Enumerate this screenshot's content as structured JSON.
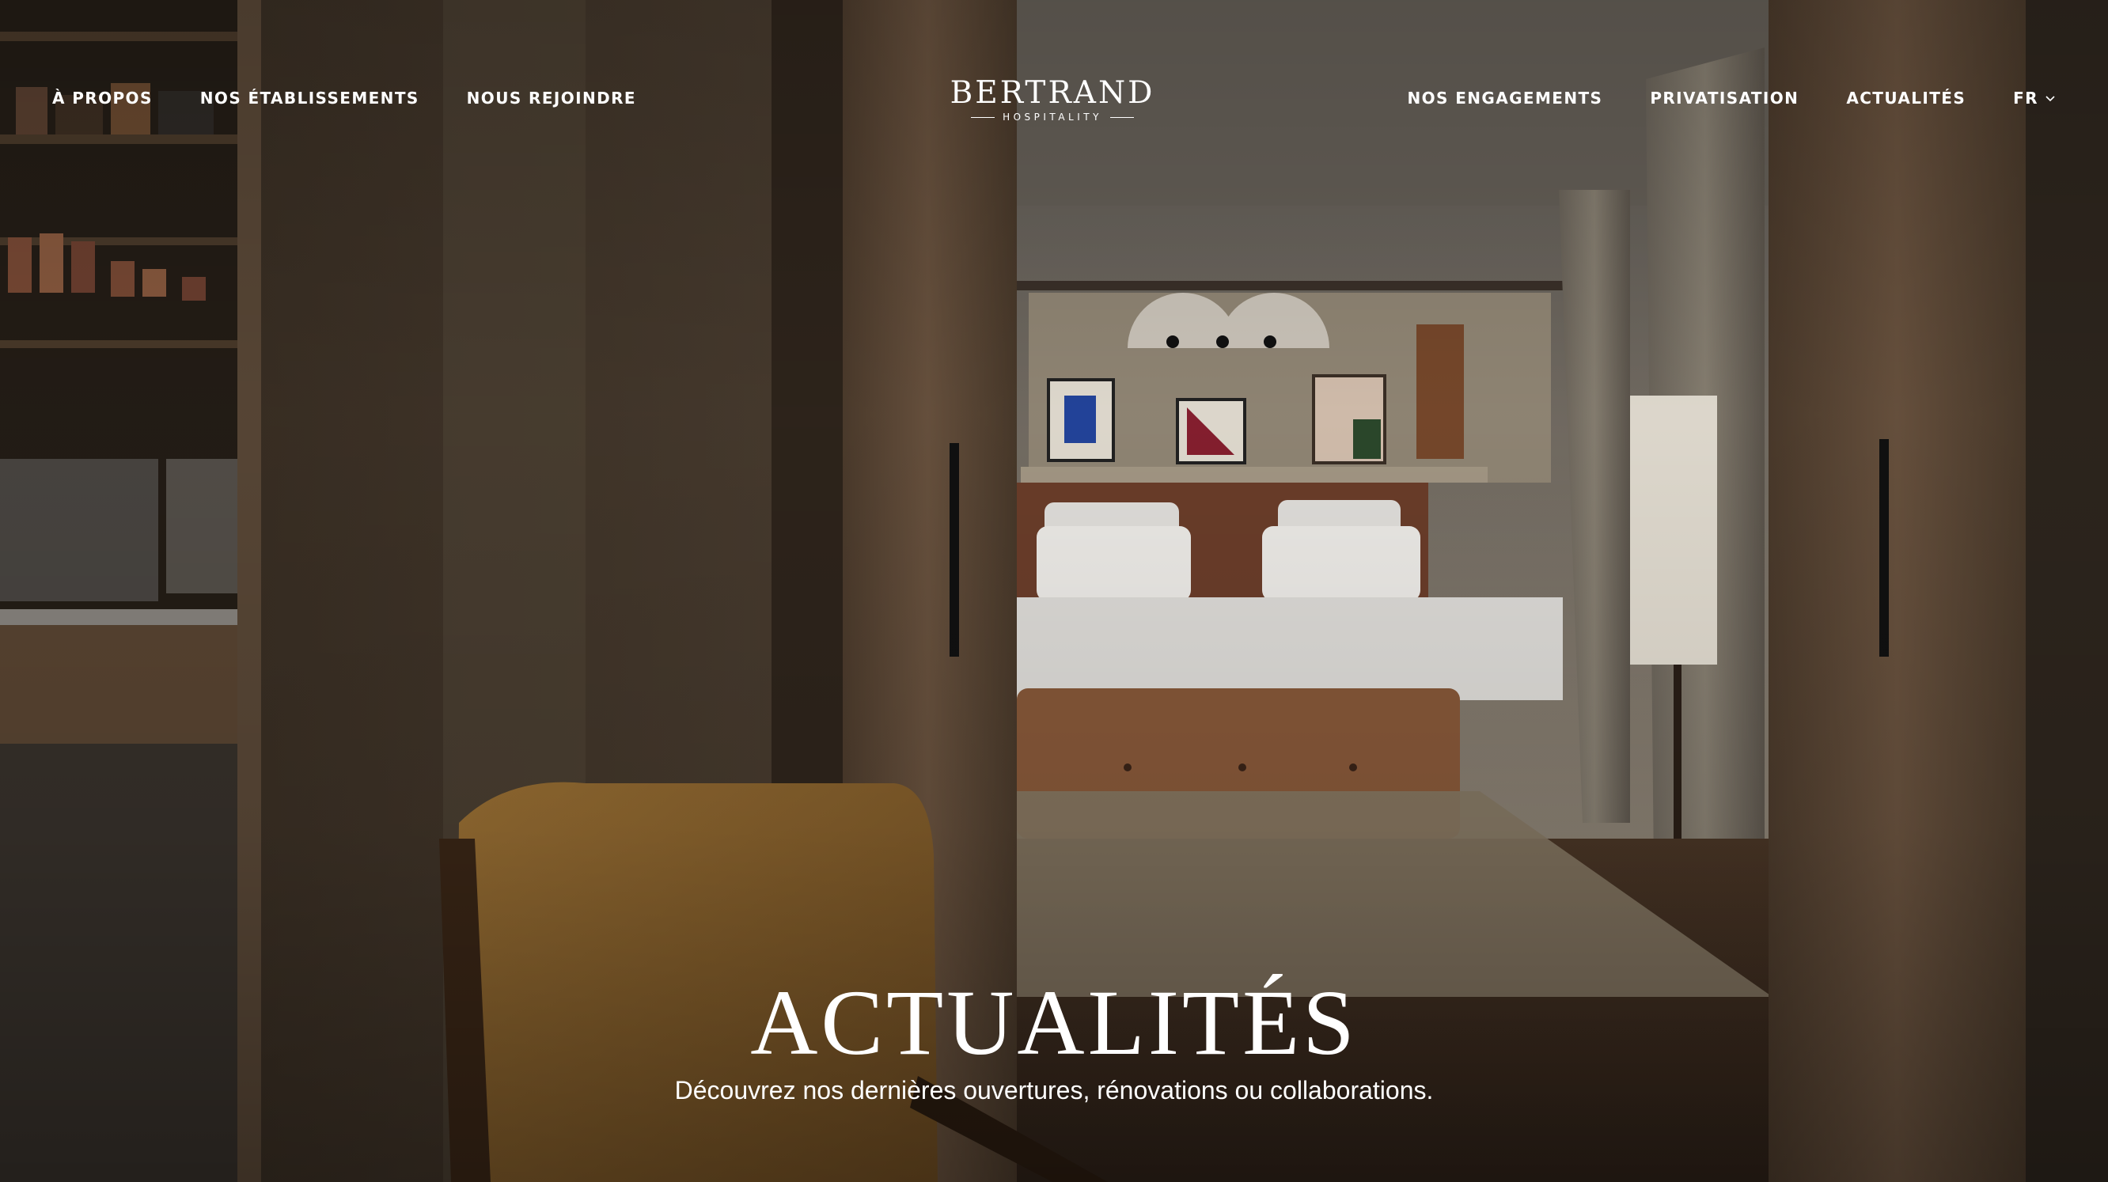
{
  "nav_left": [
    {
      "label": "À PROPOS"
    },
    {
      "label": "NOS ÉTABLISSEMENTS"
    },
    {
      "label": "NOUS REJOINDRE"
    }
  ],
  "logo": {
    "word": "BERTRAND",
    "sub": "HOSPITALITY"
  },
  "nav_right": [
    {
      "label": "NOS ENGAGEMENTS"
    },
    {
      "label": "PRIVATISATION"
    },
    {
      "label": "ACTUALITÉS"
    }
  ],
  "language": {
    "label": "FR",
    "icon": "chevron-down-icon"
  },
  "hero": {
    "title": "ACTUALITÉS",
    "subtitle": "Découvrez nos dernières ouvertures, rénovations ou collaborations."
  },
  "colors": {
    "text": "#ffffff",
    "wood": "#6b5644",
    "leather": "#8a5a3a",
    "chair": "#9a7034"
  }
}
